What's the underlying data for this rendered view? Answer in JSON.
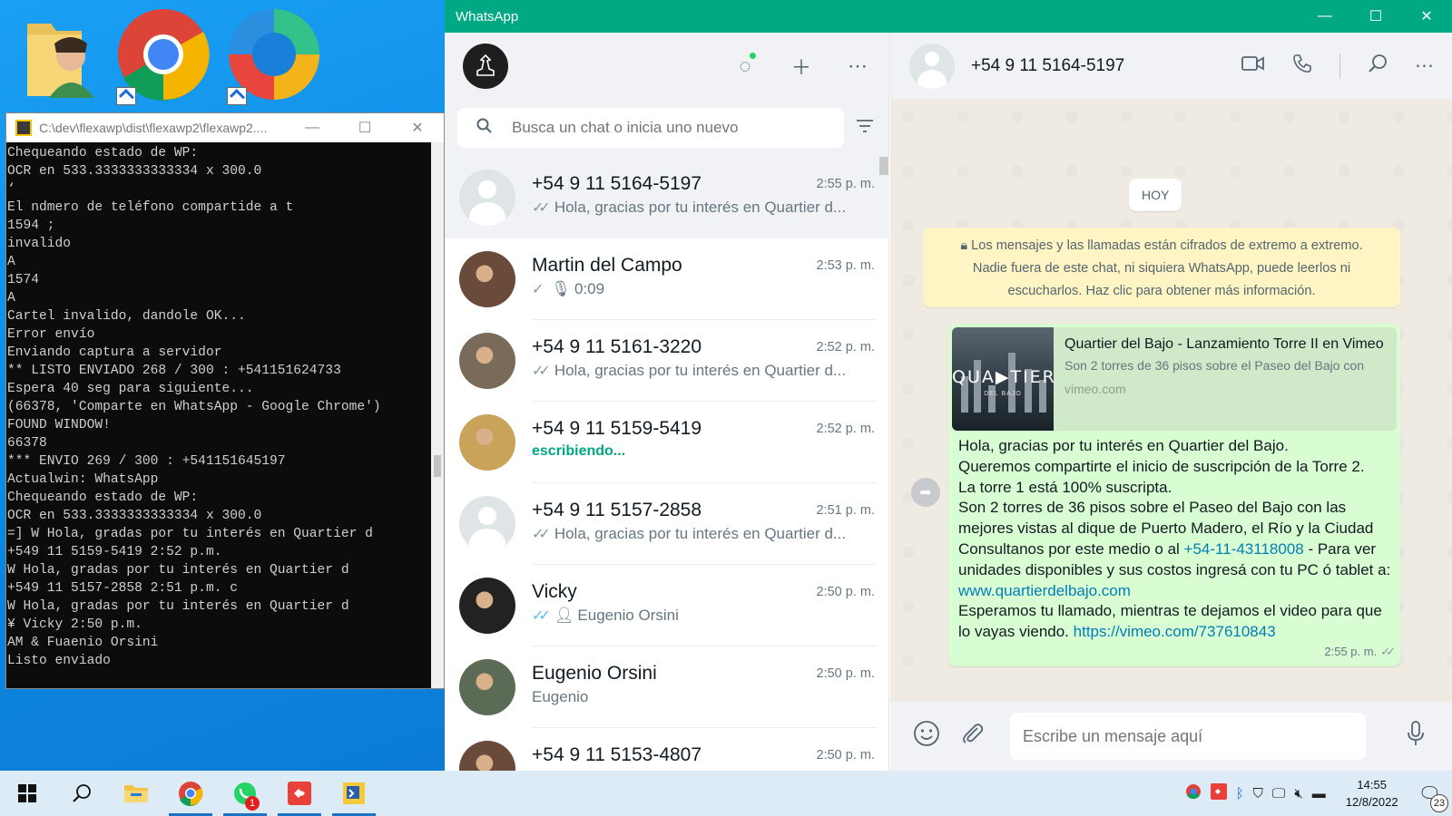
{
  "console": {
    "title": "C:\\dev\\flexawp\\dist\\flexawp2\\flexawp2....",
    "lines": [
      "Chequeando estado de WP:",
      "OCR en 533.3333333333334 x 300.0",
      "‘",
      "El ndmero de teléfono compartide a t",
      "1594 ;",
      "invalido",
      "A",
      "1574",
      "A",
      "Cartel invalido, dandole OK...",
      "Error envío",
      "Enviando captura a servidor",
      "** LISTO ENVIADO 268 / 300 : +541151624733",
      "Espera 40 seg para siguiente...",
      "(66378, 'Comparte en WhatsApp - Google Chrome')",
      "FOUND WINDOW!",
      "66378",
      "*** ENVIO 269 / 300 : +541151645197",
      "Actualwin: WhatsApp",
      "Chequeando estado de WP:",
      "OCR en 533.3333333333334 x 300.0",
      "=] W Hola, gradas por tu interés en Quartier d",
      "+549 11 5159-5419 2:52 p.m.",
      "W Hola, gradas por tu interés en Quartier d",
      "+549 11 5157-2858 2:51 p.m. c",
      "W Hola, gradas por tu interés en Quartier d",
      "¥ Vicky 2:50 p.m.",
      "AM & Fuaenio Orsini",
      "Listo enviado"
    ]
  },
  "whatsapp": {
    "window_title": "WhatsApp",
    "search_placeholder": "Busca un chat o inicia uno nuevo",
    "chats": [
      {
        "name": "+54 9 11 5164-5197",
        "time": "2:55 p. m.",
        "preview": "Hola, gracias por tu interés en Quartier d...",
        "tick": "double-grey",
        "avatar": "default"
      },
      {
        "name": "Martin del Campo",
        "time": "2:53 p. m.",
        "preview": "0:09",
        "tick": "single-mic",
        "avatar": "photo"
      },
      {
        "name": "+54 9 11 5161-3220",
        "time": "2:52 p. m.",
        "preview": "Hola, gracias por tu interés en Quartier d...",
        "tick": "double-grey",
        "avatar": "photo"
      },
      {
        "name": "+54 9 11 5159-5419",
        "time": "2:52 p. m.",
        "preview": "escribiendo...",
        "tick": "typing",
        "avatar": "photo"
      },
      {
        "name": "+54 9 11 5157-2858",
        "time": "2:51 p. m.",
        "preview": "Hola, gracias por tu interés en Quartier d...",
        "tick": "double-grey",
        "avatar": "default"
      },
      {
        "name": "Vicky",
        "time": "2:50 p. m.",
        "preview": "Eugenio Orsini",
        "tick": "double-blue-contact",
        "avatar": "photo"
      },
      {
        "name": "Eugenio Orsini",
        "time": "2:50 p. m.",
        "preview": "Eugenio",
        "tick": "none",
        "avatar": "photo"
      },
      {
        "name": "+54 9 11 5153-4807",
        "time": "2:50 p. m.",
        "preview": "",
        "tick": "none",
        "avatar": "photo"
      }
    ],
    "active_chat": {
      "name": "+54 9 11 5164-5197",
      "day_label": "HOY",
      "encryption_note": [
        "Los mensajes y las llamadas están cifrados de extremo a extremo.",
        "Nadie fuera de este chat, ni siquiera WhatsApp, puede leerlos ni",
        "escucharlos. Haz clic para obtener más información."
      ],
      "link_preview": {
        "title": "Quartier del Bajo - Lanzamiento Torre II en Vimeo",
        "description": "Son 2 torres de 36 pisos sobre el Paseo del Bajo con",
        "domain": "vimeo.com",
        "thumb_text": "QUA▶TIER",
        "thumb_sub": "DEL BAJO"
      },
      "message": {
        "p1": "Hola, gracias por tu interés en Quartier del Bajo.",
        "p2": "Queremos compartirte el inicio de suscripción de la Torre 2.",
        "p3": "La torre 1 está 100% suscripta.",
        "p4a": "Son 2 torres de 36 pisos sobre el Paseo del Bajo con las mejores vistas al dique de Puerto Madero, el Río y la Ciudad Consultanos por este medio o al ",
        "phone_link": "+54-11-43118008",
        "p4b": " - Para ver unidades disponibles y sus costos ingresá con tu PC ó tablet a: ",
        "site_link": "www.quartierdelbajo.com",
        "p5a": "Esperamos tu llamado, mientras te dejamos el video para que lo vayas viendo. ",
        "video_link": "https://vimeo.com/737610843",
        "time": "2:55 p. m.",
        "ticks": "✓✓"
      },
      "compose_placeholder": "Escribe un mensaje aquí"
    }
  },
  "taskbar": {
    "time": "14:55",
    "date": "12/8/2022",
    "whatsapp_badge": "1",
    "notification_count": "23"
  },
  "colors": {
    "accent": "#00a884",
    "bubble_out": "#d9fdd3",
    "link": "#027eb5",
    "enc_note_bg": "#fff5c4"
  }
}
